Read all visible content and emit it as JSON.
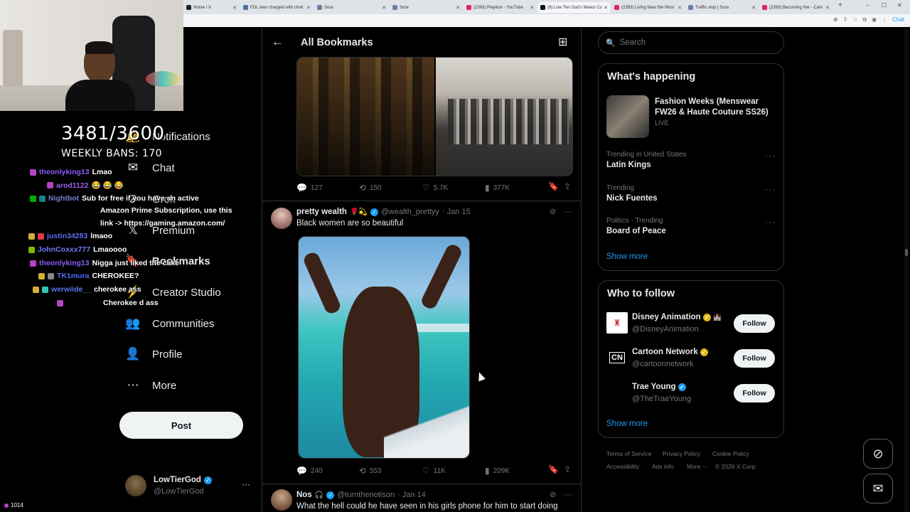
{
  "browser": {
    "tabs": [
      {
        "label": "Home / X",
        "color": "#222222"
      },
      {
        "label": "FDL teen charged with chok",
        "color": "#4a6fa5"
      },
      {
        "label": "Sora",
        "color": "#6b7fa8"
      },
      {
        "label": "Sora",
        "color": "#6b7fa8"
      },
      {
        "label": "(2393) Playlists - YouTube",
        "color": "#e0245e"
      },
      {
        "label": "(8) Low Tier God's Manor Co",
        "color": "#111111"
      },
      {
        "label": "(2393) Living Near the Most",
        "color": "#e0245e"
      },
      {
        "label": "Traffic stop | Sora",
        "color": "#6b7fa8"
      },
      {
        "label": "(2393) Becoming Her - Cam",
        "color": "#e0245e"
      }
    ],
    "new_tab": "+",
    "controls": {
      "minimize": "–",
      "maximize": "☐",
      "close": "✕"
    },
    "chat_button": "Chat"
  },
  "stream": {
    "counter": "3481/3600",
    "weekly_bans": "WEEKLY BANS: 170",
    "viewers": "1014",
    "chat": [
      {
        "user": "theonlyking13",
        "user_color": "#8a5cf5",
        "msg": "Lmao"
      },
      {
        "user": "arod1122",
        "user_color": "#9b5de5",
        "msg": "😂 😂 😂"
      },
      {
        "user": "Nightbot",
        "user_color": "#7b7bd6",
        "msg": "Sub for free if you have an active"
      },
      {
        "user": "",
        "user_color": "#ffffff",
        "msg": "Amazon Prime Subscription, use this"
      },
      {
        "user": "",
        "user_color": "#ffffff",
        "msg": "link -> https://gaming.amazon.com/"
      },
      {
        "user": "justin34283",
        "user_color": "#5b6cf0",
        "msg": "lmaoo"
      },
      {
        "user": "JohnCoxxx777",
        "user_color": "#6a7bf5",
        "msg": "Lmaoooo"
      },
      {
        "user": "theonlyking13",
        "user_color": "#8a5cf5",
        "msg": "Nigga just liked the cake"
      },
      {
        "user": "TK1mura",
        "user_color": "#4f6ef7",
        "msg": "CHEROKEE?"
      },
      {
        "user": "werwiide__",
        "user_color": "#5577ee",
        "msg": "cherokee ass"
      },
      {
        "user": "",
        "user_color": "#ffffff",
        "msg": "Cherokee d ass"
      }
    ]
  },
  "nav": {
    "items": [
      {
        "label": "Notifications",
        "icon": "bell-icon",
        "glyph": "🔔"
      },
      {
        "label": "Chat",
        "icon": "mail-icon",
        "glyph": "✉"
      },
      {
        "label": "Grok",
        "icon": "grok-icon",
        "glyph": "⊘"
      },
      {
        "label": "Premium",
        "icon": "x-icon",
        "glyph": "𝕏"
      },
      {
        "label": "Bookmarks",
        "icon": "bookmark-icon",
        "glyph": "🔖"
      },
      {
        "label": "Creator Studio",
        "icon": "lightning-icon",
        "glyph": "⚡"
      },
      {
        "label": "Communities",
        "icon": "people-icon",
        "glyph": "👥"
      },
      {
        "label": "Profile",
        "icon": "person-icon",
        "glyph": "👤"
      },
      {
        "label": "More",
        "icon": "more-circle-icon",
        "glyph": "⋯"
      }
    ],
    "post_label": "Post",
    "account": {
      "name": "LowTierGod",
      "handle": "@LowTierGod",
      "more": "···"
    }
  },
  "bookmarks": {
    "title": "All Bookmarks",
    "post1": {
      "replies": "127",
      "reposts": "150",
      "likes": "5.7K",
      "views": "377K"
    },
    "post2": {
      "name": "pretty wealth",
      "emoji": "🌹💫",
      "handle": "@wealth_prettyy",
      "date": "· Jan 15",
      "text": "Black women are so beautiful",
      "replies": "240",
      "reposts": "553",
      "likes": "11K",
      "views": "209K"
    },
    "post3": {
      "name": "Nos",
      "emoji": "🎧",
      "handle": "@turnthenotison",
      "date": "· Jan 14",
      "text": "What the hell could he have seen in his girls phone for him to start doing"
    }
  },
  "search": {
    "placeholder": "Search"
  },
  "happening": {
    "title": "What's happening",
    "featured": {
      "title": "Fashion Weeks (Menswear FW26 & Haute Couture SS26)",
      "status": "LIVE"
    },
    "trends": [
      {
        "meta": "Trending in United States",
        "name": "Latin Kings"
      },
      {
        "meta": "Trending",
        "name": "Nick Fuentes"
      },
      {
        "meta": "Politics · Trending",
        "name": "Board of Peace"
      }
    ],
    "show_more": "Show more"
  },
  "who_to_follow": {
    "title": "Who to follow",
    "accounts": [
      {
        "name": "Disney Animation",
        "handle": "@DisneyAnimation",
        "follow": "Follow"
      },
      {
        "name": "Cartoon Network",
        "handle": "@cartoonnetwork",
        "follow": "Follow",
        "logo": "CN"
      },
      {
        "name": "Trae Young",
        "handle": "@TheTraeYoung",
        "follow": "Follow"
      }
    ],
    "show_more": "Show more"
  },
  "footer": {
    "links": [
      "Terms of Service",
      "Privacy Policy",
      "Cookie Policy",
      "Accessibility",
      "Ads info",
      "More ···",
      "© 2026 X Corp."
    ]
  },
  "colors": {
    "accent": "#1d9bf0",
    "background": "#000000",
    "border": "#2f3336",
    "muted": "#71767b"
  }
}
